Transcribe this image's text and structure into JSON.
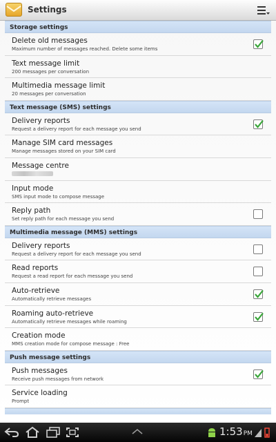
{
  "header": {
    "title": "Settings"
  },
  "sections": [
    {
      "title": "Storage settings",
      "items": [
        {
          "label": "Delete old messages",
          "desc": "Maximum number of messages reached. Delete some items",
          "checkbox": true,
          "checked": true
        },
        {
          "label": "Text message limit",
          "desc": "200 messages per conversation"
        },
        {
          "label": "Multimedia message limit",
          "desc": "20 messages per conversation"
        }
      ]
    },
    {
      "title": "Text message (SMS) settings",
      "items": [
        {
          "label": "Delivery reports",
          "desc": "Request a delivery report for each message you send",
          "checkbox": true,
          "checked": true
        },
        {
          "label": "Manage SIM card messages",
          "desc": "Manage messages stored on your SIM card"
        },
        {
          "label": "Message centre",
          "desc": ""
        },
        {
          "label": "Input mode",
          "desc": "SMS input mode to compose message"
        },
        {
          "label": "Reply path",
          "desc": "Set reply path for each message you send",
          "checkbox": true,
          "checked": false
        }
      ]
    },
    {
      "title": "Multimedia message (MMS) settings",
      "items": [
        {
          "label": "Delivery reports",
          "desc": "Request a delivery report for each message you send",
          "checkbox": true,
          "checked": false
        },
        {
          "label": "Read reports",
          "desc": "Request a read report for each message you send",
          "checkbox": true,
          "checked": false
        },
        {
          "label": "Auto-retrieve",
          "desc": "Automatically retrieve messages",
          "checkbox": true,
          "checked": true
        },
        {
          "label": "Roaming auto-retrieve",
          "desc": "Automatically retrieve messages while roaming",
          "checkbox": true,
          "checked": true
        },
        {
          "label": "Creation mode",
          "desc": "MMS creation mode for compose message : Free"
        }
      ]
    },
    {
      "title": "Push message settings",
      "items": [
        {
          "label": "Push messages",
          "desc": "Receive push messages from network",
          "checkbox": true,
          "checked": true
        },
        {
          "label": "Service loading",
          "desc": "Prompt"
        }
      ]
    }
  ],
  "statusbar": {
    "time": "1:53",
    "ampm": "PM"
  },
  "colors": {
    "accent_check": "#3aa63a",
    "section_bg": "#c8dbf1"
  }
}
